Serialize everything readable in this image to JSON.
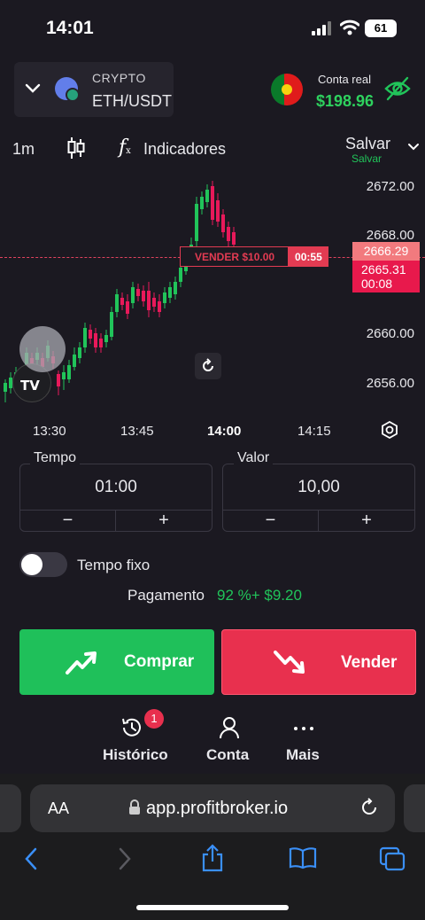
{
  "status": {
    "time": "14:01",
    "battery": "61"
  },
  "asset": {
    "category": "CRYPTO",
    "pair": "ETH/USDT"
  },
  "account": {
    "label": "Conta real",
    "balance": "$198.96"
  },
  "toolbar": {
    "interval": "1m",
    "indicators": "Indicadores",
    "save": "Salvar",
    "save_sub": "Salvar"
  },
  "chart": {
    "price_labels": [
      "2672.00",
      "2668.00",
      "2660.00",
      "2656.00"
    ],
    "time_labels": [
      "13:30",
      "13:45",
      "14:00",
      "14:15"
    ],
    "current_price": "2666.29",
    "sell_price": "2665.31",
    "sell_timer": "00:08",
    "order_label": "VENDER $10.00",
    "order_timer": "00:55"
  },
  "chart_data": {
    "type": "candlestick",
    "x": [
      "13:30",
      "13:45",
      "14:00",
      "14:15"
    ],
    "ylim": [
      2654,
      2674
    ],
    "y_ticks": [
      2656,
      2660,
      2668,
      2672
    ],
    "current_price": 2666.29,
    "order_price": 2665.31
  },
  "trade": {
    "time_label": "Tempo",
    "time_value": "01:00",
    "amount_label": "Valor",
    "amount_value": "10,00",
    "minus": "−",
    "plus": "+",
    "fixed_time": "Tempo fixo",
    "payout_label": "Pagamento",
    "payout_value": "92 %+ $9.20",
    "buy": "Comprar",
    "sell": "Vender"
  },
  "tabs": {
    "history": "Histórico",
    "history_badge": "1",
    "account": "Conta",
    "more": "Mais"
  },
  "browser": {
    "text_size": "AA",
    "url": "app.profitbroker.io"
  },
  "colors": {
    "buy": "#1fc05a",
    "sell": "#e8304e",
    "up_candle": "#21c45a",
    "down_candle": "#e8195a"
  }
}
